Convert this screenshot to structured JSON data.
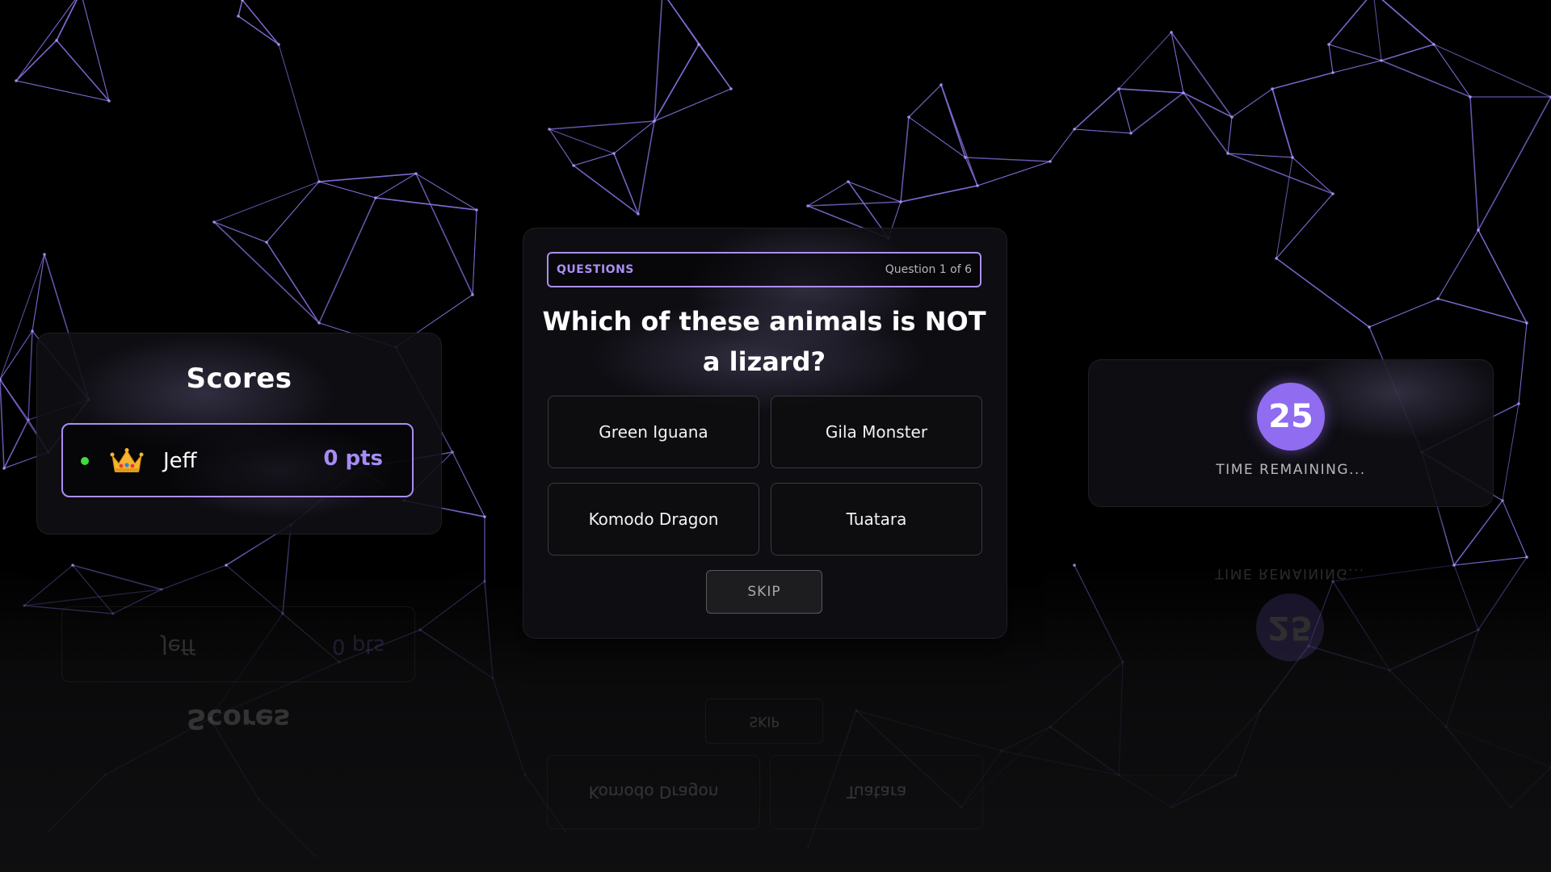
{
  "scores": {
    "title": "Scores",
    "players": [
      {
        "name": "Jeff",
        "points": "0 pts",
        "online": true,
        "badge": "crown-icon"
      }
    ]
  },
  "question": {
    "header_label": "QUESTIONS",
    "counter": "Question 1 of 6",
    "text": "Which of these animals is NOT a lizard?",
    "answers": [
      "Green Iguana",
      "Gila Monster",
      "Komodo Dragon",
      "Tuatara"
    ],
    "skip_label": "SKIP"
  },
  "timer": {
    "seconds": "25",
    "label": "TIME REMAINING..."
  },
  "colors": {
    "accent": "#a98ff2",
    "timer_fill": "#8f6cf0",
    "online": "#3fdc3f",
    "background": "#000000",
    "network_lines": "#8a6fe0"
  }
}
